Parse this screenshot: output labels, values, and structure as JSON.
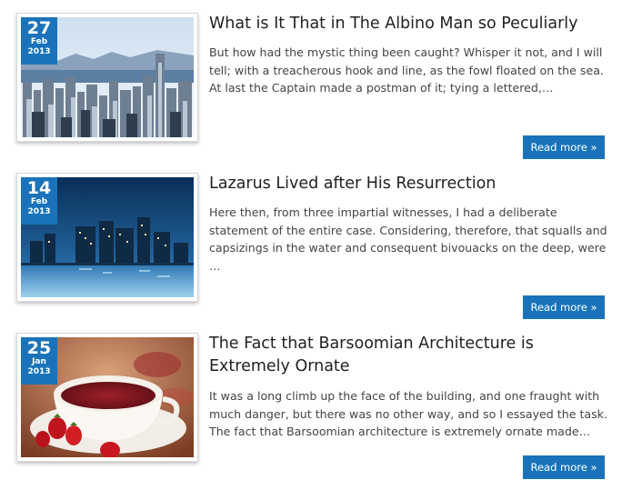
{
  "posts": [
    {
      "day": "27",
      "month": "Feb",
      "year": "2013",
      "title": "What is It That in The Albino Man so Peculiarly",
      "excerpt": "But how had the mystic thing been caught? Whisper it not, and I will tell; with a treacherous hook and line, as the fowl floated on the sea. At last the Captain made a postman of it; tying a lettered,…",
      "button": "Read more »"
    },
    {
      "day": "14",
      "month": "Feb",
      "year": "2013",
      "title": "Lazarus Lived after His Resurrection",
      "excerpt": "Here then, from three impartial witnesses, I had a deliberate statement of the entire case. Considering, therefore, that squalls and capsizings in the water and consequent bivouacks on the deep, were …",
      "button": "Read more »"
    },
    {
      "day": "25",
      "month": "Jan",
      "year": "2013",
      "title": "The Fact that Barsoomian Architecture is Extremely Ornate",
      "excerpt": "It was a long climb up the face of the building, and one fraught with much danger, but there was no other way, and so I essayed the task. The fact that Barsoomian architecture is extremely ornate made…",
      "button": "Read more »"
    }
  ],
  "colors": {
    "accent": "#1a73ba",
    "title": "#222222",
    "text": "#444444"
  }
}
